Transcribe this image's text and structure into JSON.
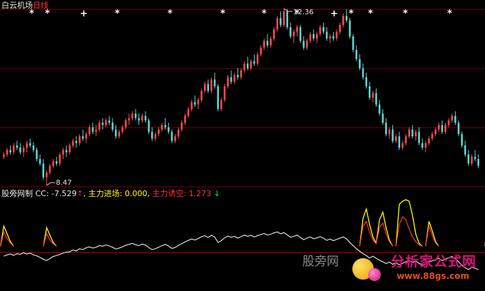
{
  "title": {
    "stock": "白云机场",
    "period": "日线"
  },
  "indicator": {
    "name": "股旁网制",
    "cc_label": "CC: ",
    "cc_value": "-7.529",
    "cc_arrow": "↑",
    "main_label": "主力进场: ",
    "main_value": "0.000,",
    "trap_label": "主力诱空: ",
    "trap_value": "1.273",
    "trap_arrow": "↓"
  },
  "watermark": {
    "brand": "股旁网",
    "site": "分析家公式网",
    "url": "www.88gs.com"
  },
  "colors": {
    "up": "#ff4a4a",
    "down": "#5fd6d6",
    "line": "#ffffff",
    "gridline": "#7a0000",
    "yellow": "#ffff00",
    "red": "#ff3333",
    "green": "#00ff00"
  },
  "chart_data": {
    "type": "candlestick",
    "annotations": [
      {
        "label": "12.36",
        "kind": "high"
      },
      {
        "label": "8.47",
        "kind": "low"
      }
    ],
    "markers": [
      "*",
      "*",
      "+",
      "*",
      "*",
      "*",
      "*",
      "*",
      "+",
      "*",
      "*"
    ],
    "candles": [
      [
        9.1,
        9.2,
        9.05,
        9.15
      ],
      [
        9.15,
        9.3,
        9.1,
        9.25
      ],
      [
        9.25,
        9.35,
        9.15,
        9.2
      ],
      [
        9.2,
        9.4,
        9.15,
        9.35
      ],
      [
        9.35,
        9.45,
        9.25,
        9.3
      ],
      [
        9.3,
        9.4,
        9.15,
        9.2
      ],
      [
        9.2,
        9.35,
        9.1,
        9.3
      ],
      [
        9.3,
        9.45,
        9.2,
        9.4
      ],
      [
        9.4,
        9.5,
        9.3,
        9.35
      ],
      [
        9.35,
        9.42,
        9.2,
        9.25
      ],
      [
        9.25,
        9.3,
        9.0,
        9.05
      ],
      [
        9.05,
        9.15,
        8.9,
        8.95
      ],
      [
        8.95,
        9.05,
        8.6,
        8.65
      ],
      [
        8.65,
        8.8,
        8.47,
        8.75
      ],
      [
        8.75,
        8.95,
        8.7,
        8.9
      ],
      [
        8.9,
        9.05,
        8.85,
        9.0
      ],
      [
        9.0,
        9.1,
        8.9,
        8.95
      ],
      [
        8.95,
        9.2,
        8.9,
        9.15
      ],
      [
        9.15,
        9.3,
        9.05,
        9.25
      ],
      [
        9.25,
        9.35,
        9.1,
        9.2
      ],
      [
        9.2,
        9.4,
        9.15,
        9.35
      ],
      [
        9.35,
        9.5,
        9.3,
        9.45
      ],
      [
        9.45,
        9.55,
        9.3,
        9.4
      ],
      [
        9.4,
        9.6,
        9.35,
        9.55
      ],
      [
        9.55,
        9.7,
        9.45,
        9.5
      ],
      [
        9.5,
        9.65,
        9.4,
        9.6
      ],
      [
        9.6,
        9.8,
        9.55,
        9.75
      ],
      [
        9.75,
        9.85,
        9.6,
        9.65
      ],
      [
        9.65,
        9.8,
        9.55,
        9.7
      ],
      [
        9.7,
        9.9,
        9.65,
        9.85
      ],
      [
        9.85,
        9.95,
        9.7,
        9.8
      ],
      [
        9.8,
        9.95,
        9.75,
        9.9
      ],
      [
        9.9,
        10.0,
        9.8,
        9.85
      ],
      [
        9.85,
        9.95,
        9.65,
        9.7
      ],
      [
        9.7,
        9.8,
        9.5,
        9.55
      ],
      [
        9.55,
        9.7,
        9.5,
        9.65
      ],
      [
        9.65,
        9.8,
        9.6,
        9.75
      ],
      [
        9.75,
        9.95,
        9.7,
        9.9
      ],
      [
        9.9,
        10.05,
        9.8,
        9.95
      ],
      [
        9.95,
        10.1,
        9.9,
        10.05
      ],
      [
        10.05,
        10.15,
        9.9,
        9.95
      ],
      [
        9.95,
        10.05,
        9.8,
        9.9
      ],
      [
        9.9,
        10.05,
        9.85,
        10.0
      ],
      [
        10.0,
        10.1,
        9.85,
        9.9
      ],
      [
        9.9,
        9.95,
        9.6,
        9.65
      ],
      [
        9.65,
        9.75,
        9.45,
        9.5
      ],
      [
        9.5,
        9.65,
        9.45,
        9.6
      ],
      [
        9.6,
        9.75,
        9.55,
        9.7
      ],
      [
        9.7,
        9.85,
        9.65,
        9.8
      ],
      [
        9.8,
        9.95,
        9.7,
        9.75
      ],
      [
        9.75,
        9.85,
        9.6,
        9.65
      ],
      [
        9.65,
        9.7,
        9.4,
        9.45
      ],
      [
        9.45,
        9.6,
        9.4,
        9.55
      ],
      [
        9.55,
        9.75,
        9.5,
        9.7
      ],
      [
        9.7,
        9.9,
        9.65,
        9.85
      ],
      [
        9.85,
        10.05,
        9.8,
        10.0
      ],
      [
        10.0,
        10.2,
        9.95,
        10.15
      ],
      [
        10.15,
        10.35,
        10.1,
        10.3
      ],
      [
        10.3,
        10.45,
        10.2,
        10.25
      ],
      [
        10.25,
        10.4,
        10.15,
        10.35
      ],
      [
        10.35,
        10.6,
        10.3,
        10.55
      ],
      [
        10.55,
        10.75,
        10.5,
        10.7
      ],
      [
        10.7,
        10.8,
        10.5,
        10.55
      ],
      [
        10.55,
        10.85,
        10.5,
        10.8
      ],
      [
        10.8,
        10.95,
        10.6,
        10.65
      ],
      [
        10.65,
        10.7,
        10.1,
        10.15
      ],
      [
        10.15,
        10.4,
        10.1,
        10.35
      ],
      [
        10.35,
        10.7,
        10.3,
        10.65
      ],
      [
        10.65,
        10.9,
        10.6,
        10.85
      ],
      [
        10.85,
        11.0,
        10.7,
        10.75
      ],
      [
        10.75,
        10.95,
        10.7,
        10.9
      ],
      [
        10.9,
        11.05,
        10.8,
        10.85
      ],
      [
        10.85,
        11.05,
        10.8,
        11.0
      ],
      [
        11.0,
        11.2,
        10.95,
        11.15
      ],
      [
        11.15,
        11.3,
        11.0,
        11.05
      ],
      [
        11.05,
        11.25,
        11.0,
        11.2
      ],
      [
        11.2,
        11.35,
        11.1,
        11.15
      ],
      [
        11.15,
        11.4,
        11.1,
        11.35
      ],
      [
        11.35,
        11.55,
        11.3,
        11.5
      ],
      [
        11.5,
        11.7,
        11.45,
        11.65
      ],
      [
        11.65,
        11.8,
        11.5,
        11.55
      ],
      [
        11.55,
        11.75,
        11.5,
        11.7
      ],
      [
        11.7,
        11.95,
        11.65,
        11.9
      ],
      [
        11.9,
        12.2,
        11.85,
        12.15
      ],
      [
        12.15,
        12.3,
        11.95,
        12.0
      ],
      [
        12.0,
        12.36,
        11.95,
        12.3
      ],
      [
        12.3,
        12.35,
        11.9,
        11.95
      ],
      [
        11.95,
        12.05,
        11.7,
        11.75
      ],
      [
        11.75,
        11.9,
        11.6,
        11.85
      ],
      [
        11.85,
        12.0,
        11.75,
        11.95
      ],
      [
        11.95,
        12.0,
        11.6,
        11.65
      ],
      [
        11.65,
        11.75,
        11.45,
        11.5
      ],
      [
        11.5,
        11.7,
        11.45,
        11.65
      ],
      [
        11.65,
        11.85,
        11.6,
        11.8
      ],
      [
        11.8,
        11.9,
        11.65,
        11.7
      ],
      [
        11.7,
        11.85,
        11.6,
        11.8
      ],
      [
        11.8,
        12.0,
        11.75,
        11.95
      ],
      [
        11.95,
        12.05,
        11.8,
        11.85
      ],
      [
        11.85,
        11.95,
        11.65,
        11.7
      ],
      [
        11.7,
        11.8,
        11.6,
        11.75
      ],
      [
        11.75,
        11.85,
        11.65,
        11.7
      ],
      [
        11.7,
        11.9,
        11.65,
        11.85
      ],
      [
        11.85,
        12.05,
        11.8,
        12.0
      ],
      [
        12.0,
        12.25,
        11.95,
        12.2
      ],
      [
        12.2,
        12.35,
        12.05,
        12.1
      ],
      [
        12.1,
        12.15,
        11.7,
        11.75
      ],
      [
        11.75,
        11.8,
        11.4,
        11.45
      ],
      [
        11.45,
        11.55,
        11.2,
        11.25
      ],
      [
        11.25,
        11.35,
        11.0,
        11.05
      ],
      [
        11.05,
        11.15,
        10.8,
        10.85
      ],
      [
        10.85,
        10.95,
        10.6,
        10.65
      ],
      [
        10.65,
        10.75,
        10.35,
        10.4
      ],
      [
        10.4,
        10.55,
        10.3,
        10.5
      ],
      [
        10.5,
        10.6,
        10.2,
        10.25
      ],
      [
        10.25,
        10.35,
        10.0,
        10.05
      ],
      [
        10.05,
        10.15,
        9.8,
        9.85
      ],
      [
        9.85,
        9.95,
        9.55,
        9.6
      ],
      [
        9.6,
        9.75,
        9.5,
        9.7
      ],
      [
        9.7,
        9.8,
        9.4,
        9.45
      ],
      [
        9.45,
        9.6,
        9.4,
        9.55
      ],
      [
        9.55,
        9.65,
        9.25,
        9.3
      ],
      [
        9.3,
        9.45,
        9.25,
        9.4
      ],
      [
        9.4,
        9.6,
        9.35,
        9.55
      ],
      [
        9.55,
        9.75,
        9.5,
        9.7
      ],
      [
        9.7,
        9.8,
        9.5,
        9.55
      ],
      [
        9.55,
        9.7,
        9.45,
        9.65
      ],
      [
        9.65,
        9.75,
        9.35,
        9.4
      ],
      [
        9.4,
        9.5,
        9.25,
        9.3
      ],
      [
        9.3,
        9.45,
        9.2,
        9.4
      ],
      [
        9.4,
        9.55,
        9.35,
        9.5
      ],
      [
        9.5,
        9.65,
        9.45,
        9.6
      ],
      [
        9.6,
        9.75,
        9.55,
        9.7
      ],
      [
        9.7,
        9.85,
        9.65,
        9.8
      ],
      [
        9.8,
        9.9,
        9.6,
        9.65
      ],
      [
        9.65,
        9.85,
        9.6,
        9.8
      ],
      [
        9.8,
        9.95,
        9.75,
        9.9
      ],
      [
        9.9,
        10.05,
        9.85,
        10.0
      ],
      [
        10.0,
        10.1,
        9.8,
        9.85
      ],
      [
        9.85,
        9.9,
        9.55,
        9.6
      ],
      [
        9.6,
        9.65,
        9.3,
        9.35
      ],
      [
        9.35,
        9.45,
        9.1,
        9.15
      ],
      [
        9.15,
        9.25,
        8.9,
        8.95
      ],
      [
        8.95,
        9.15,
        8.9,
        9.1
      ],
      [
        9.1,
        9.25,
        9.0,
        9.05
      ],
      [
        9.05,
        9.15,
        8.85,
        8.9
      ]
    ],
    "cc": [
      -3.2,
      -2.8,
      -2.5,
      -2.9,
      -2.4,
      -2.6,
      -2.1,
      -2.5,
      -2.2,
      -2.8,
      -3.1,
      -3.6,
      -4.2,
      -4.6,
      -4.0,
      -3.3,
      -3.0,
      -2.6,
      -2.2,
      -1.9,
      -1.8,
      -1.2,
      -1.5,
      -0.8,
      -1.1,
      -0.5,
      -0.2,
      -0.6,
      -0.3,
      0.2,
      0.0,
      0.4,
      0.1,
      -0.3,
      -0.9,
      -0.6,
      -0.2,
      0.3,
      0.6,
      0.9,
      0.5,
      0.2,
      0.7,
      0.4,
      -0.4,
      -1.1,
      -0.8,
      -0.3,
      0.2,
      0.6,
      0.1,
      -0.7,
      -0.4,
      0.3,
      0.8,
      1.4,
      1.9,
      2.3,
      2.0,
      2.5,
      3.1,
      3.4,
      2.8,
      3.5,
      3.0,
      1.2,
      1.8,
      2.7,
      3.3,
      2.9,
      3.2,
      2.6,
      3.1,
      3.6,
      3.2,
      3.5,
      3.0,
      3.4,
      3.8,
      4.1,
      3.6,
      3.9,
      4.3,
      4.6,
      4.0,
      4.4,
      3.7,
      2.9,
      3.2,
      3.6,
      2.8,
      2.1,
      2.6,
      3.0,
      2.4,
      2.7,
      3.1,
      2.6,
      1.9,
      2.3,
      1.8,
      2.2,
      2.6,
      3.0,
      2.4,
      1.2,
      0.2,
      -0.8,
      -1.6,
      -2.4,
      -3.0,
      -3.8,
      -3.2,
      -3.9,
      -4.5,
      -5.0,
      -5.6,
      -5.1,
      -5.8,
      -5.3,
      -6.0,
      -5.5,
      -5.0,
      -4.6,
      -5.2,
      -4.8,
      -5.5,
      -6.1,
      -5.6,
      -5.1,
      -4.7,
      -4.3,
      -3.9,
      -4.6,
      -4.2,
      -3.7,
      -3.3,
      -4.0,
      -5.0,
      -6.1,
      -6.9,
      -7.5,
      -6.8,
      -7.1,
      -7.529
    ],
    "main_force": [
      [
        0,
        6.5
      ],
      [
        1,
        4.0
      ],
      [
        2,
        1.5
      ],
      [
        13,
        6.0
      ],
      [
        14,
        3.5
      ],
      [
        15,
        1.2
      ],
      [
        109,
        9.0
      ],
      [
        110,
        12.0
      ],
      [
        111,
        7.0
      ],
      [
        112,
        3.0
      ],
      [
        113,
        1.0
      ],
      [
        114,
        8.5
      ],
      [
        115,
        11.0
      ],
      [
        116,
        6.0
      ],
      [
        117,
        2.0
      ],
      [
        120,
        13.5
      ],
      [
        121,
        14.5
      ],
      [
        122,
        15.0
      ],
      [
        123,
        14.5
      ],
      [
        124,
        10.0
      ],
      [
        125,
        4.0
      ],
      [
        126,
        1.0
      ],
      [
        129,
        8.0
      ],
      [
        130,
        5.0
      ],
      [
        131,
        1.5
      ],
      [
        147,
        10.0
      ],
      [
        148,
        7.0
      ],
      [
        149,
        3.0
      ],
      [
        150,
        1.0
      ]
    ],
    "trap": [
      [
        0,
        4.5
      ],
      [
        1,
        2.5
      ],
      [
        2,
        1.0
      ],
      [
        13,
        4.0
      ],
      [
        14,
        2.0
      ],
      [
        15,
        0.8
      ],
      [
        109,
        6.5
      ],
      [
        110,
        8.0
      ],
      [
        111,
        4.5
      ],
      [
        112,
        2.0
      ],
      [
        113,
        0.8
      ],
      [
        114,
        6.0
      ],
      [
        115,
        7.5
      ],
      [
        116,
        4.0
      ],
      [
        117,
        1.5
      ],
      [
        120,
        7.0
      ],
      [
        121,
        9.5
      ],
      [
        122,
        8.5
      ],
      [
        123,
        5.5
      ],
      [
        124,
        3.0
      ],
      [
        125,
        1.5
      ],
      [
        126,
        0.5
      ],
      [
        129,
        6.5
      ],
      [
        130,
        3.5
      ],
      [
        131,
        1.0
      ],
      [
        147,
        8.0
      ],
      [
        148,
        5.5
      ],
      [
        149,
        2.5
      ],
      [
        150,
        0.8
      ]
    ]
  }
}
